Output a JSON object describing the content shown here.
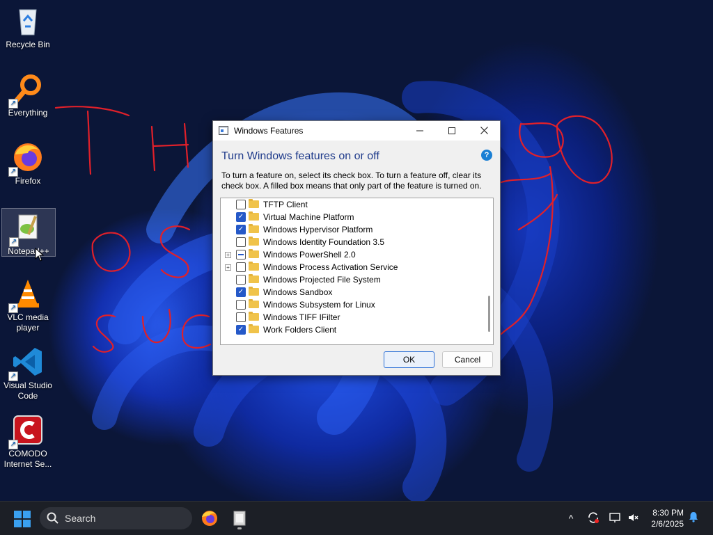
{
  "desktop": {
    "icons": [
      {
        "label": "Recycle Bin"
      },
      {
        "label": "Everything"
      },
      {
        "label": "Firefox"
      },
      {
        "label": "Notepad++"
      },
      {
        "label": "VLC media player"
      },
      {
        "label": "Visual Studio Code"
      },
      {
        "label": "COMODO Internet Se..."
      }
    ]
  },
  "dialog": {
    "title": "Windows Features",
    "heading": "Turn Windows features on or off",
    "help": "?",
    "description": "To turn a feature on, select its check box. To turn a feature off, clear its check box. A filled box means that only part of the feature is turned on.",
    "features": [
      {
        "label": "TFTP Client",
        "state": "off",
        "expandable": false
      },
      {
        "label": "Virtual Machine Platform",
        "state": "on",
        "expandable": false
      },
      {
        "label": "Windows Hypervisor Platform",
        "state": "on",
        "expandable": false
      },
      {
        "label": "Windows Identity Foundation 3.5",
        "state": "off",
        "expandable": false
      },
      {
        "label": "Windows PowerShell 2.0",
        "state": "partial",
        "expandable": true
      },
      {
        "label": "Windows Process Activation Service",
        "state": "off",
        "expandable": true
      },
      {
        "label": "Windows Projected File System",
        "state": "off",
        "expandable": false
      },
      {
        "label": "Windows Sandbox",
        "state": "on",
        "expandable": false
      },
      {
        "label": "Windows Subsystem for Linux",
        "state": "off",
        "expandable": false
      },
      {
        "label": "Windows TIFF IFilter",
        "state": "off",
        "expandable": false
      },
      {
        "label": "Work Folders Client",
        "state": "on",
        "expandable": false
      }
    ],
    "ok_label": "OK",
    "cancel_label": "Cancel"
  },
  "taskbar": {
    "search_label": "Search",
    "time": "8:30 PM",
    "date": "2/6/2025"
  },
  "colors": {
    "accent": "#2559c8",
    "scribble": "#e0202a"
  }
}
